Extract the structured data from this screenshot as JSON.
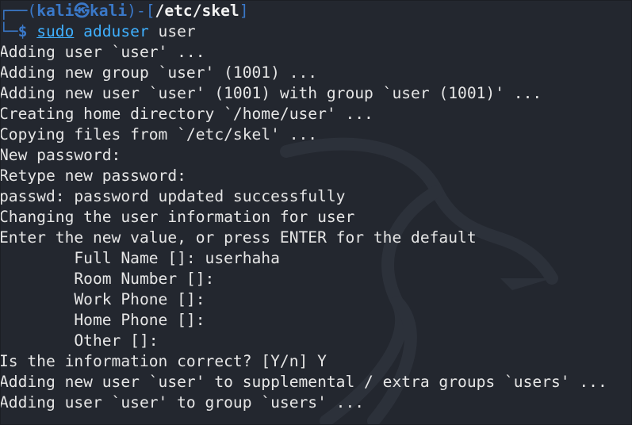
{
  "window": {
    "background": "#23272f",
    "accent": "#3a78c8",
    "command_color": "#3fb0ff"
  },
  "prompt": {
    "corner_top": "┌──",
    "open_paren": "(",
    "user": "kali",
    "at_symbol": "㉿",
    "host": "kali",
    "close_bracket_sep": ")-[",
    "cwd": "/etc/skel",
    "close_bracket": "]",
    "corner_bottom": "└─",
    "dollar": "$",
    "command": "sudo",
    "program": "adduser",
    "argument": "user"
  },
  "output": [
    "Adding user `user' ...",
    "Adding new group `user' (1001) ...",
    "Adding new user `user' (1001) with group `user (1001)' ...",
    "Creating home directory `/home/user' ...",
    "Copying files from `/etc/skel' ...",
    "New password:",
    "Retype new password:",
    "passwd: password updated successfully",
    "Changing the user information for user",
    "Enter the new value, or press ENTER for the default",
    "\tFull Name []: userhaha",
    "\tRoom Number []:",
    "\tWork Phone []:",
    "\tHome Phone []:",
    "\tOther []:",
    "Is the information correct? [Y/n] Y",
    "Adding new user `user' to supplemental / extra groups `users' ...",
    "Adding user `user' to group `users' ..."
  ]
}
